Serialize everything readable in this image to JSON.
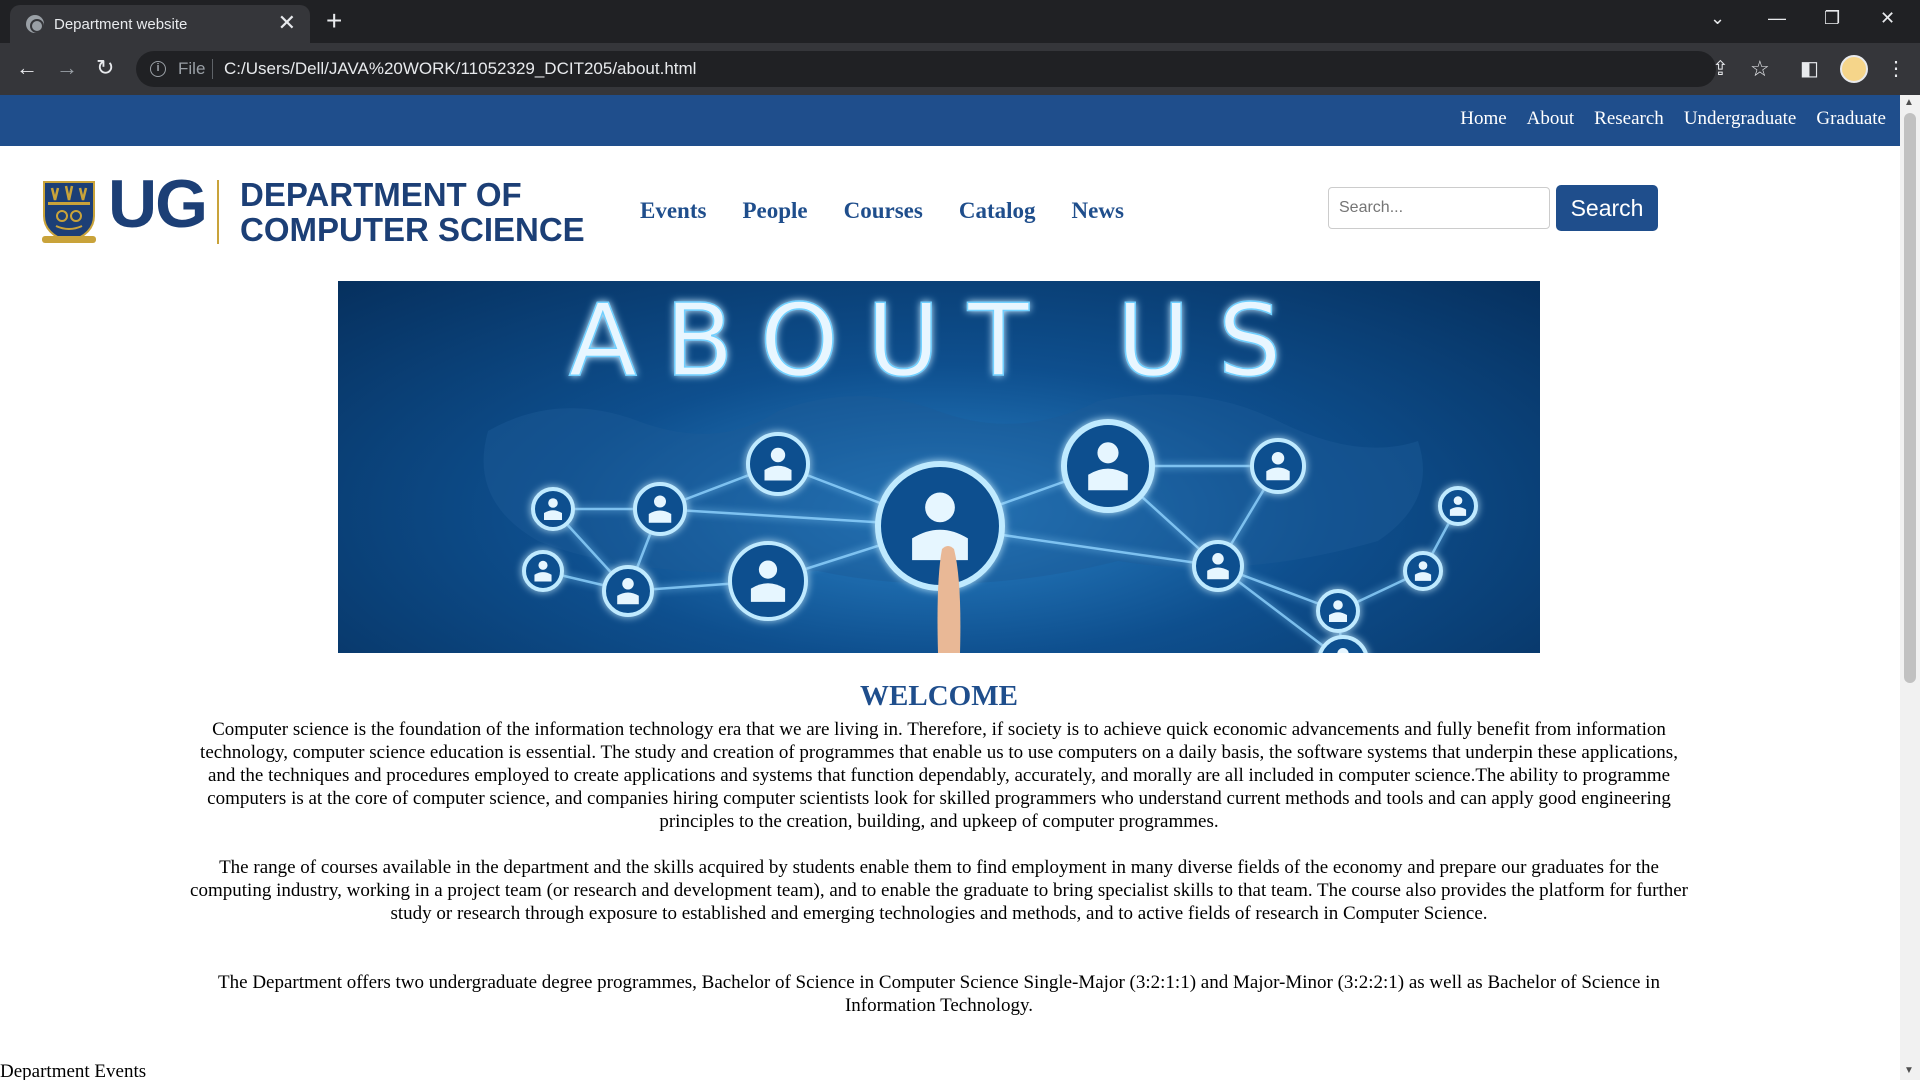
{
  "browser": {
    "tab_title": "Department website",
    "tab_close": "✕",
    "new_tab": "+",
    "scheme_label": "File",
    "url": "C:/Users/Dell/JAVA%20WORK/11052329_DCIT205/about.html"
  },
  "topnav": {
    "links": [
      "Home",
      "About",
      "Research",
      "Undergraduate",
      "Graduate"
    ]
  },
  "header": {
    "logo_ug": "UG",
    "logo_line1": "DEPARTMENT OF",
    "logo_line2": "COMPUTER SCIENCE",
    "nav": [
      "Events",
      "People",
      "Courses",
      "Catalog",
      "News"
    ],
    "search_placeholder": "Search...",
    "search_button": "Search"
  },
  "hero": {
    "text": "ABOUT US"
  },
  "content": {
    "heading": "WELCOME",
    "paragraphs": [
      "Computer science is the foundation of the information technology era that we are living in. Therefore, if society is to achieve quick economic advancements and fully benefit from information technology, computer science education is essential. The study and creation of programmes that enable us to use computers on a daily basis, the software systems that underpin these applications, and the techniques and procedures employed to create applications and systems that function dependably, accurately, and morally are all included in computer science.The ability to programme computers is at the core of computer science, and companies hiring computer scientists look for skilled programmers who understand current methods and tools and can apply good engineering principles to the creation, building, and upkeep of computer programmes.",
      "The range of courses available in the department and the skills acquired by students enable them to find employment in many diverse fields of the economy and prepare our graduates for the computing industry, working in a project team (or research and development team), and to enable the graduate to bring specialist skills to that team. The course also provides the platform for further study or research through exposure to established and emerging technologies and methods, and to active fields of research in Computer Science.",
      "The Department offers two undergraduate degree programmes, Bachelor of Science in Computer Science Single-Major (3:2:1:1) and Major-Minor (3:2:2:1) as well as Bachelor of Science in Information Technology."
    ],
    "cut_off_heading": "Department Events"
  },
  "colors": {
    "brand_blue": "#1f4e8c",
    "logo_navy": "#1c3f76",
    "logo_gold": "#c9a33a",
    "chrome_dark": "#202124",
    "chrome_toolbar": "#35363a"
  },
  "icons": [
    "globe-icon",
    "close-icon",
    "plus-icon",
    "chevron-down-icon",
    "minimize-icon",
    "restore-icon",
    "window-close-icon",
    "back-arrow-icon",
    "forward-arrow-icon",
    "reload-icon",
    "info-icon",
    "share-icon",
    "star-icon",
    "side-panel-icon",
    "kebab-menu-icon",
    "university-crest-icon"
  ]
}
